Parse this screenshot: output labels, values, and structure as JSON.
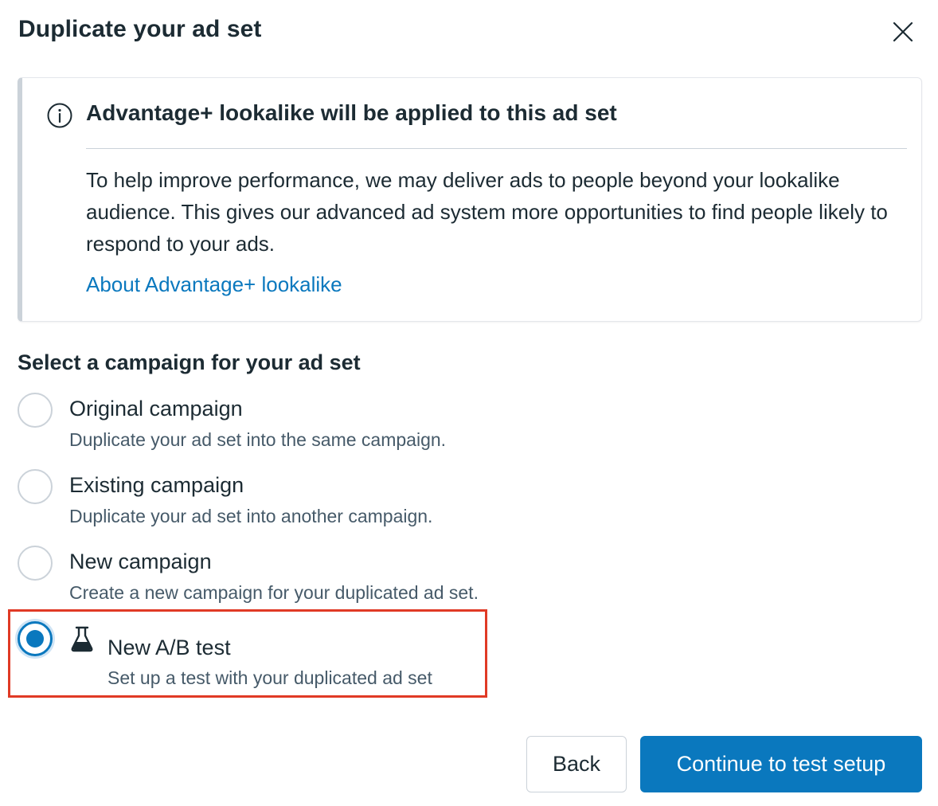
{
  "dialog": {
    "title": "Duplicate your ad set",
    "close_icon": "close-icon"
  },
  "notice": {
    "icon": "info-icon",
    "title": "Advantage+ lookalike will be applied to this ad set",
    "body": "To help improve performance, we may deliver ads to people beyond your lookalike audience. This gives our advanced ad system more opportunities to find people likely to respond to your ads.",
    "link": "About Advantage+ lookalike"
  },
  "campaign_select": {
    "heading": "Select a campaign for your ad set",
    "selected": "New A/B test",
    "options": [
      {
        "label": "Original campaign",
        "description": "Duplicate your ad set into the same campaign.",
        "checked": false
      },
      {
        "label": "Existing campaign",
        "description": "Duplicate your ad set into another campaign.",
        "checked": false
      },
      {
        "label": "New campaign",
        "description": "Create a new campaign for your duplicated ad set.",
        "checked": false
      },
      {
        "label": "New A/B test",
        "description": "Set up a test with your duplicated ad set",
        "checked": true,
        "icon": "flask-icon"
      }
    ]
  },
  "footer": {
    "back_label": "Back",
    "continue_label": "Continue to test setup"
  },
  "colors": {
    "primary": "#0a78be",
    "text": "#1c2b33",
    "secondary_text": "#465a69",
    "highlight": "#e03a25",
    "border": "#cbd2d9"
  }
}
